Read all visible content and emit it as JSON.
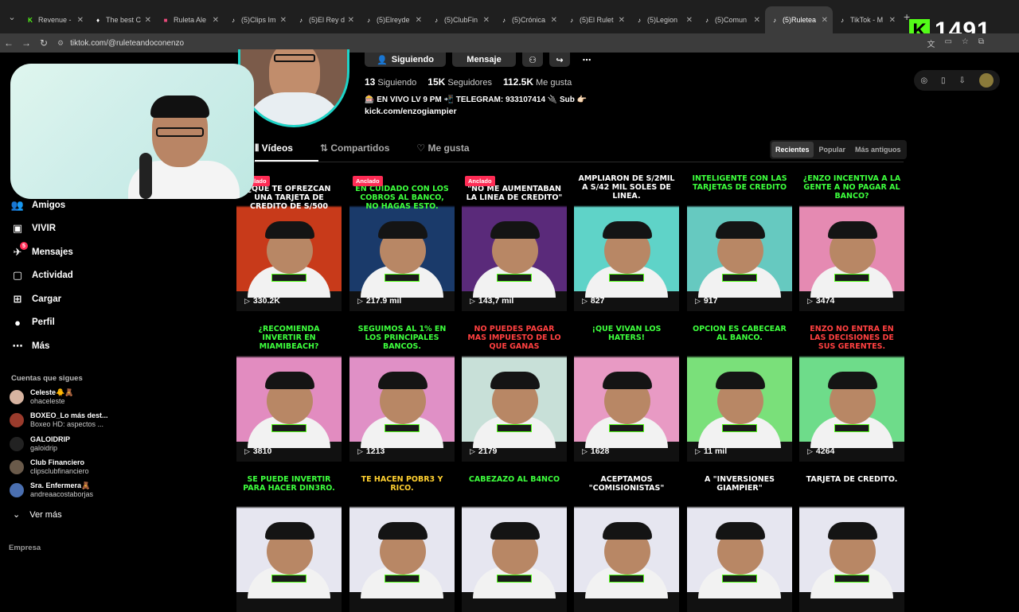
{
  "browser": {
    "tabs": [
      {
        "title": "Revenue -",
        "fav": "K",
        "fav_color": "#53fc18",
        "active": false
      },
      {
        "title": "The best C",
        "fav": "♦",
        "fav_color": "#ffffff",
        "active": false
      },
      {
        "title": "Ruleta Ale",
        "fav": "■",
        "fav_color": "#e84a7a",
        "active": false
      },
      {
        "title": "(5)Clips Im",
        "fav": "♪",
        "fav_color": "#ffffff",
        "active": false
      },
      {
        "title": "(5)El Rey d",
        "fav": "♪",
        "fav_color": "#ffffff",
        "active": false
      },
      {
        "title": "(5)Elreyde",
        "fav": "♪",
        "fav_color": "#ffffff",
        "active": false
      },
      {
        "title": "(5)ClubFin",
        "fav": "♪",
        "fav_color": "#ffffff",
        "active": false
      },
      {
        "title": "(5)Crónica",
        "fav": "♪",
        "fav_color": "#ffffff",
        "active": false
      },
      {
        "title": "(5)El Rulet",
        "fav": "♪",
        "fav_color": "#ffffff",
        "active": false
      },
      {
        "title": "(5)Legion",
        "fav": "♪",
        "fav_color": "#ffffff",
        "active": false
      },
      {
        "title": "(5)Comun",
        "fav": "♪",
        "fav_color": "#ffffff",
        "active": false
      },
      {
        "title": "(5)Ruletea",
        "fav": "♪",
        "fav_color": "#ffffff",
        "active": true
      },
      {
        "title": "TikTok - M",
        "fav": "♪",
        "fav_color": "#ffffff",
        "active": false
      }
    ],
    "url": "tiktok.com/@ruleteandoconenzo",
    "kick_count": "1491"
  },
  "sidebar": {
    "items": [
      {
        "label": "Amigos",
        "icon": "friends-icon",
        "glyph": "👥"
      },
      {
        "label": "VIVIR",
        "icon": "live-icon",
        "glyph": "▣"
      },
      {
        "label": "Mensajes",
        "icon": "messages-icon",
        "glyph": "✈",
        "badge": "5"
      },
      {
        "label": "Actividad",
        "icon": "activity-icon",
        "glyph": "▢"
      },
      {
        "label": "Cargar",
        "icon": "upload-icon",
        "glyph": "⊞"
      },
      {
        "label": "Perfil",
        "icon": "profile-icon",
        "glyph": "●"
      },
      {
        "label": "Más",
        "icon": "more-icon",
        "glyph": "⋯"
      }
    ],
    "following_title": "Cuentas que sigues",
    "following": [
      {
        "name": "Celeste🐥🧸",
        "handle": "ohaceleste",
        "color": "#d7b3a0"
      },
      {
        "name": "BOXEO_Lo más dest...",
        "handle": "Boxeo HD: aspectos ...",
        "color": "#9a3b2c"
      },
      {
        "name": "GALOIDRIP",
        "handle": "galoidrip",
        "color": "#222222"
      },
      {
        "name": "Club Financiero",
        "handle": "clipsclubfinanciero",
        "color": "#6a5a4a"
      },
      {
        "name": "Sra. Enfermera🧸",
        "handle": "andreaacostaborjas",
        "color": "#4a6fb0"
      }
    ],
    "see_more": "Ver más",
    "company": "Empresa"
  },
  "profile": {
    "follow_label": "Siguiendo",
    "message_label": "Mensaje",
    "stats": [
      {
        "value": "13",
        "label": "Siguiendo"
      },
      {
        "value": "15K",
        "label": "Seguidores"
      },
      {
        "value": "112.5K",
        "label": "Me gusta"
      }
    ],
    "bio": "🎰 EN VIVO LV 9 PM 📲 TELEGRAM: 933107414 🔌 Sub 👉🏻",
    "link": "kick.com/enzogiampier"
  },
  "tabs": {
    "videos": "Vídeos",
    "shared": "Compartidos",
    "liked": "Me gusta"
  },
  "sort": {
    "recent": "Recientes",
    "popular": "Popular",
    "oldest": "Más antiguos"
  },
  "pinned_label": "Anclado",
  "videos": [
    {
      "caption": "¿QUE TE OFREZCAN UNA TARJETA DE CREDITO DE S/500",
      "views": "330.2K",
      "pinned": true,
      "bg": "#c83a1a",
      "cap_color": "#ffffff"
    },
    {
      "caption": "EN CUIDADO CON LOS COBROS AL BANCO, NO HAGAS ESTO.",
      "views": "217.9 mil",
      "pinned": true,
      "bg": "#1a3a6a",
      "cap_color": "#3dff3d"
    },
    {
      "caption": "\"NO ME AUMENTABAN LA LINEA DE CREDITO\"",
      "views": "143,7 mil",
      "pinned": true,
      "bg": "#5a2a7a",
      "cap_color": "#ffffff"
    },
    {
      "caption": "AMPLIARON DE S/2MIL A S/42 MIL SOLES DE LINEA.",
      "views": "827",
      "pinned": false,
      "bg": "#5fd3c8",
      "cap_color": "#ffffff"
    },
    {
      "caption": "INTELIGENTE CON LAS TARJETAS DE CREDITO",
      "views": "917",
      "pinned": false,
      "bg": "#66c9c0",
      "cap_color": "#3dff3d"
    },
    {
      "caption": "¿ENZO INCENTIVA A LA GENTE A NO PAGAR AL BANCO?",
      "views": "3474",
      "pinned": false,
      "bg": "#e58ab2",
      "cap_color": "#3dff3d"
    },
    {
      "caption": "¿RECOMIENDA INVERTIR EN MIAMIBEACH?",
      "views": "3810",
      "pinned": false,
      "bg": "#e28cc0",
      "cap_color": "#3dff3d"
    },
    {
      "caption": "SEGUIMOS AL 1% EN LOS PRINCIPALES BANCOS.",
      "views": "1213",
      "pinned": false,
      "bg": "#e090c6",
      "cap_color": "#3dff3d"
    },
    {
      "caption": "NO PUEDES PAGAR MAS IMPUESTO DE LO QUE GANAS",
      "views": "2179",
      "pinned": false,
      "bg": "#c8e0d8",
      "cap_color": "#ff4040"
    },
    {
      "caption": "¡QUE VIVAN LOS HATERS!",
      "views": "1628",
      "pinned": false,
      "bg": "#e89ac4",
      "cap_color": "#3dff3d"
    },
    {
      "caption": "OPCION ES CABECEAR AL BANCO.",
      "views": "11 mil",
      "pinned": false,
      "bg": "#7ae07a",
      "cap_color": "#3dff3d"
    },
    {
      "caption": "ENZO NO ENTRA EN LAS DECISIONES DE SUS GERENTES.",
      "views": "4264",
      "pinned": false,
      "bg": "#6edc8a",
      "cap_color": "#ff4040"
    },
    {
      "caption": "SE PUEDE INVERTIR PARA HACER DIN3RO.",
      "views": "",
      "pinned": false,
      "bg": "#e6e6f0",
      "cap_color": "#3dff3d"
    },
    {
      "caption": "TE HACEN POBR3 Y RICO.",
      "views": "",
      "pinned": false,
      "bg": "#e6e6f0",
      "cap_color": "#ffd030"
    },
    {
      "caption": "CABEZAZO AL B4NCO",
      "views": "",
      "pinned": false,
      "bg": "#e6e6f0",
      "cap_color": "#3dff3d"
    },
    {
      "caption": "ACEPTAMOS \"COMISIONISTAS\"",
      "views": "",
      "pinned": false,
      "bg": "#e6e6f0",
      "cap_color": "#ffffff"
    },
    {
      "caption": "A \"INVERSIONES GIAMPIER\"",
      "views": "",
      "pinned": false,
      "bg": "#e6e6f0",
      "cap_color": "#ffffff"
    },
    {
      "caption": "TARJETA DE CREDITO.",
      "views": "",
      "pinned": false,
      "bg": "#e6e6f0",
      "cap_color": "#ffffff"
    }
  ]
}
